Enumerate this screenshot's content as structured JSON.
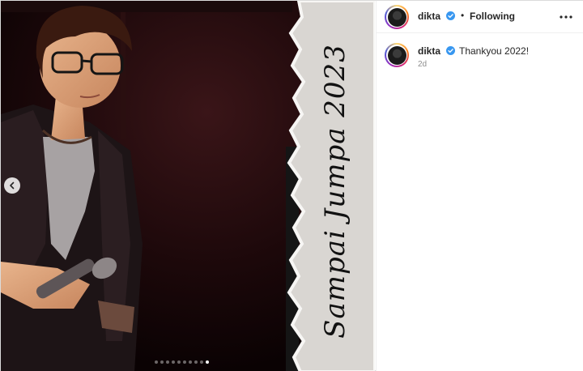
{
  "post": {
    "media": {
      "overlay_text": "Sampai Jumpa 2023",
      "carousel": {
        "total": 10,
        "active_index": 9
      }
    },
    "header": {
      "username": "dikta",
      "separator": "•",
      "follow_label": "Following"
    },
    "caption": {
      "username": "dikta",
      "text": "Thankyou 2022!",
      "time": "2d"
    }
  },
  "colors": {
    "verified": "#3897f0",
    "text": "#262626",
    "muted": "#8e8e8e"
  },
  "icons": [
    "chevron-left-icon",
    "verified-badge-icon",
    "more-options-icon"
  ]
}
